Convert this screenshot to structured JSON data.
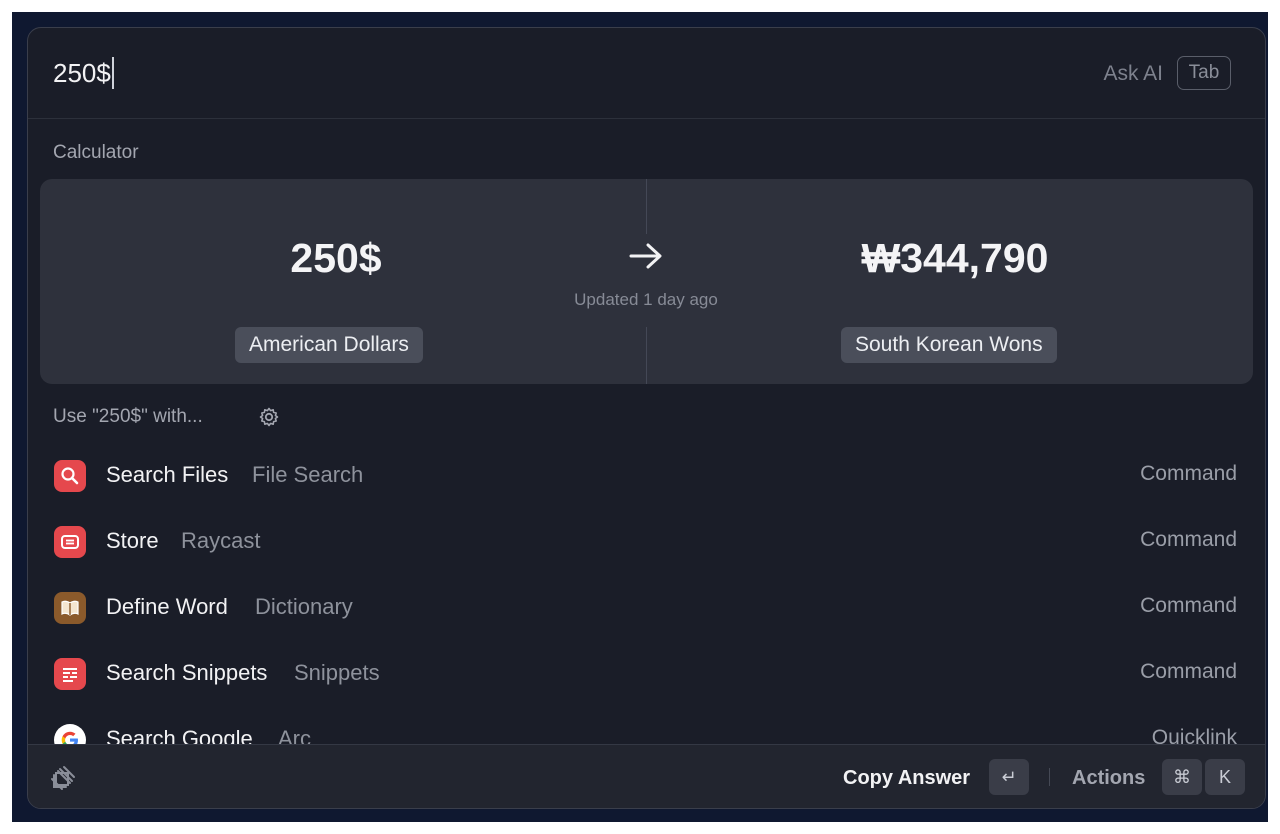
{
  "search": {
    "query": "250$",
    "ask_ai_label": "Ask AI",
    "tab_key": "Tab"
  },
  "calculator": {
    "section_title": "Calculator",
    "input_value": "250$",
    "input_unit": "American Dollars",
    "result_value": "₩344,790",
    "result_unit": "South Korean Wons",
    "updated_text": "Updated 1 day ago"
  },
  "use_with": {
    "label": "Use \"250$\" with..."
  },
  "results": [
    {
      "title": "Search Files",
      "subtitle": "File Search",
      "type": "Command",
      "icon": "search-files-icon",
      "color": "#e5484d"
    },
    {
      "title": "Store",
      "subtitle": "Raycast",
      "type": "Command",
      "icon": "store-icon",
      "color": "#e5484d"
    },
    {
      "title": "Define Word",
      "subtitle": "Dictionary",
      "type": "Command",
      "icon": "dictionary-icon",
      "color": "#8b5a2b"
    },
    {
      "title": "Search Snippets",
      "subtitle": "Snippets",
      "type": "Command",
      "icon": "snippets-icon",
      "color": "#e5484d"
    },
    {
      "title": "Search Google",
      "subtitle": "Arc",
      "type": "Quicklink",
      "icon": "google-icon",
      "color": "#ffffff"
    }
  ],
  "footer": {
    "primary_action": "Copy Answer",
    "enter_key": "↵",
    "actions_label": "Actions",
    "cmd_key": "⌘",
    "k_key": "K"
  }
}
